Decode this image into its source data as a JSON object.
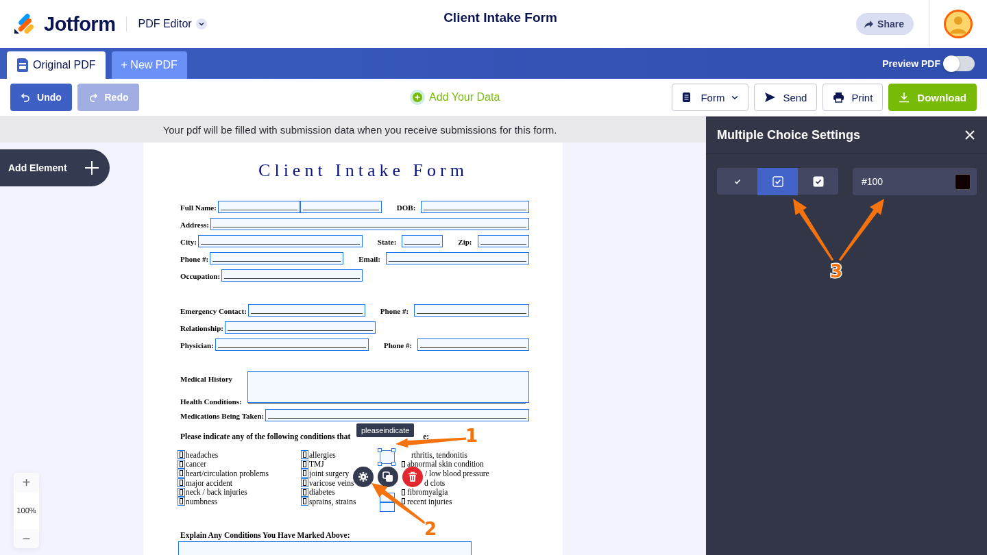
{
  "header": {
    "brand": "Jotform",
    "product": "PDF Editor",
    "title": "Client Intake Form",
    "share": "Share"
  },
  "tabs": [
    {
      "label": "Original PDF",
      "selected": true
    },
    {
      "label": "+ New PDF",
      "selected": false
    }
  ],
  "preview": {
    "label": "Preview PDF",
    "on": false
  },
  "toolbar": {
    "history": [
      {
        "kind": "undo",
        "label": "Undo",
        "disabled": false
      },
      {
        "kind": "redo",
        "label": "Redo",
        "disabled": true
      }
    ],
    "add_data": "Add Your Data",
    "actions": [
      {
        "kind": "form",
        "label": "Form"
      },
      {
        "kind": "send",
        "label": "Send"
      },
      {
        "kind": "print",
        "label": "Print"
      },
      {
        "kind": "download",
        "label": "Download"
      }
    ]
  },
  "notice": "Your pdf will be filled with submission data when you receive submissions for this form.",
  "add_element": "Add Element",
  "zoom": {
    "zoom_in": "+",
    "level": "100%",
    "zoom_out": "−"
  },
  "document": {
    "title": "Client Intake Form",
    "rows": [
      {
        "kind": "line",
        "items": [
          {
            "kind": "label",
            "text": "Full Name:"
          },
          {
            "kind": "field"
          },
          {
            "kind": "field"
          },
          {
            "kind": "label",
            "text": "DOB:"
          },
          {
            "kind": "field"
          }
        ]
      },
      {
        "kind": "line",
        "items": [
          {
            "kind": "label",
            "text": "Address:"
          },
          {
            "kind": "field"
          }
        ]
      },
      {
        "kind": "line",
        "items": [
          {
            "kind": "label",
            "text": "City:"
          },
          {
            "kind": "field"
          },
          {
            "kind": "label",
            "text": "State:"
          },
          {
            "kind": "field"
          },
          {
            "kind": "label",
            "text": "Zip:"
          },
          {
            "kind": "field"
          }
        ]
      },
      {
        "kind": "line",
        "items": [
          {
            "kind": "label",
            "text": "Phone #:"
          },
          {
            "kind": "field"
          },
          {
            "kind": "label",
            "text": "Email:"
          },
          {
            "kind": "field"
          }
        ]
      },
      {
        "kind": "line",
        "items": [
          {
            "kind": "label",
            "text": "Occupation:"
          },
          {
            "kind": "field"
          }
        ]
      },
      {
        "kind": "line",
        "items": [
          {
            "kind": "label",
            "text": "Emergency Contact:"
          },
          {
            "kind": "field"
          },
          {
            "kind": "label",
            "text": "Phone #:"
          },
          {
            "kind": "field"
          }
        ]
      },
      {
        "kind": "line",
        "items": [
          {
            "kind": "label",
            "text": "Relationship:"
          },
          {
            "kind": "field"
          }
        ]
      },
      {
        "kind": "line",
        "items": [
          {
            "kind": "label",
            "text": "Physician:"
          },
          {
            "kind": "field"
          },
          {
            "kind": "label",
            "text": "Phone #:"
          },
          {
            "kind": "field"
          }
        ]
      },
      {
        "kind": "stacked",
        "items": [
          {
            "kind": "label",
            "text": "Medical History"
          },
          {
            "kind": "label",
            "text": "Health Conditions:"
          },
          {
            "kind": "field"
          }
        ]
      },
      {
        "kind": "line",
        "items": [
          {
            "kind": "label",
            "text": "Medications Being Taken:"
          },
          {
            "kind": "field"
          }
        ]
      }
    ],
    "heading": [
      "Please indicate any of the following conditions that",
      "e:"
    ],
    "tooltip": "pleaseindicate",
    "columns": [
      {
        "kind": "boxed",
        "items": [
          {
            "text": "headaches",
            "glyph": true
          },
          {
            "text": "cancer",
            "glyph": true
          },
          {
            "text": "heart/circulation problems",
            "glyph": true
          },
          {
            "text": "major accident",
            "glyph": true
          },
          {
            "text": "neck / back injuries",
            "glyph": true
          },
          {
            "text": "numbness",
            "glyph": true
          }
        ]
      },
      {
        "kind": "boxed",
        "items": [
          {
            "text": "allergies",
            "glyph": true
          },
          {
            "text": "TMJ",
            "glyph": true
          },
          {
            "text": "joint surgery",
            "glyph": true
          },
          {
            "text": "varicose veins",
            "glyph": true
          },
          {
            "text": "diabetes",
            "glyph": true
          },
          {
            "text": "sprains, strains",
            "glyph": true
          }
        ]
      },
      {
        "kind": "grouped",
        "items": [
          {
            "text": "rthritis, tendonitis",
            "glyph": false
          },
          {
            "text": "abnormal skin condition",
            "glyph": true
          },
          {
            "text": "/ low blood pressure",
            "glyph": false
          },
          {
            "text": "d clots",
            "glyph": false
          },
          {
            "text": "fibromyalgia",
            "glyph": true
          },
          {
            "text": "recent injuries",
            "glyph": true
          }
        ]
      }
    ],
    "explain": "Explain Any Conditions You Have Marked Above:"
  },
  "panel": {
    "title": "Multiple Choice Settings",
    "styles": [
      {
        "kind": "plain",
        "selected": false
      },
      {
        "kind": "outline",
        "selected": true
      },
      {
        "kind": "filled",
        "selected": false
      }
    ],
    "color": "#100"
  },
  "annotations": [
    {
      "label": "1"
    },
    {
      "label": "2"
    },
    {
      "label": "3"
    }
  ]
}
